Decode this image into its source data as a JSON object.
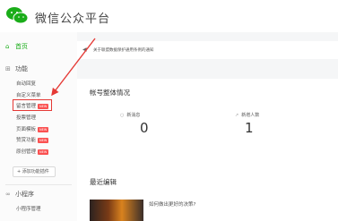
{
  "header": {
    "title": "微信公众平台",
    "logo_icon": "wechat-logo-icon",
    "brand_color": "#1aad19"
  },
  "sidebar": {
    "home": {
      "label": "首页",
      "icon": "home-icon"
    },
    "function_section": {
      "label": "功能",
      "icon": "grid-icon"
    },
    "function_items": [
      {
        "label": "自动回复"
      },
      {
        "label": "自定义菜单"
      },
      {
        "label": "留言管理",
        "badge": "NEW",
        "highlighted": true
      },
      {
        "label": "投票管理"
      },
      {
        "label": "页面模板",
        "badge": "NEW"
      },
      {
        "label": "赞赏功能",
        "badge": "NEW"
      },
      {
        "label": "原创管理",
        "badge": "NEW"
      }
    ],
    "add_plugin_label": "+ 添加功能插件",
    "mini_program_section": {
      "label": "小程序",
      "icon": "mini-program-icon"
    },
    "mini_program_items": [
      {
        "label": "小程序管理"
      }
    ]
  },
  "notice": {
    "icon": "speaker-icon",
    "text": "关于联盟数据保护通用条例的通知"
  },
  "overview": {
    "title": "帐号整体情况",
    "stats": [
      {
        "label": "新消息",
        "value": "0",
        "icon": "message-icon"
      },
      {
        "label": "新增人数",
        "value": "1",
        "icon": "trend-up-icon"
      }
    ]
  },
  "recent": {
    "title": "最近编辑",
    "items": [
      {
        "title": "如何做出更好的决策?"
      }
    ]
  },
  "colors": {
    "annotation_red": "#e53935",
    "badge_red": "#fa5151"
  }
}
